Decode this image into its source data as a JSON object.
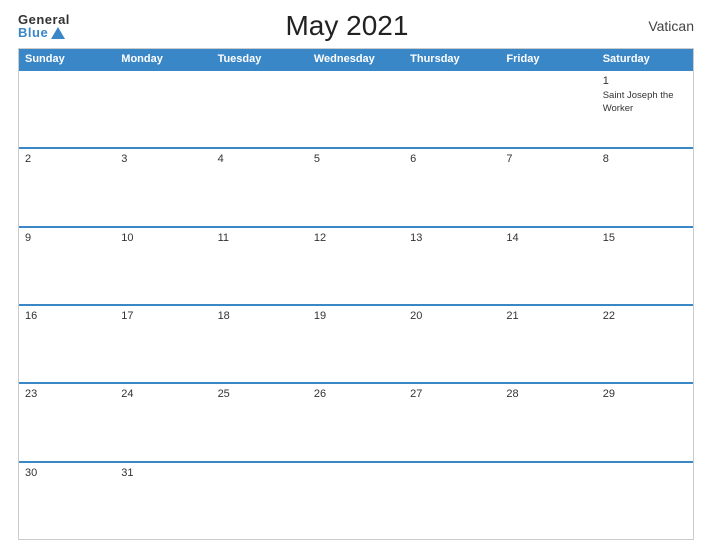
{
  "header": {
    "logo_general": "General",
    "logo_blue": "Blue",
    "title": "May 2021",
    "country": "Vatican"
  },
  "calendar": {
    "day_headers": [
      "Sunday",
      "Monday",
      "Tuesday",
      "Wednesday",
      "Thursday",
      "Friday",
      "Saturday"
    ],
    "weeks": [
      [
        {
          "date": "",
          "event": ""
        },
        {
          "date": "",
          "event": ""
        },
        {
          "date": "",
          "event": ""
        },
        {
          "date": "",
          "event": ""
        },
        {
          "date": "",
          "event": ""
        },
        {
          "date": "",
          "event": ""
        },
        {
          "date": "1",
          "event": "Saint Joseph the Worker"
        }
      ],
      [
        {
          "date": "2",
          "event": ""
        },
        {
          "date": "3",
          "event": ""
        },
        {
          "date": "4",
          "event": ""
        },
        {
          "date": "5",
          "event": ""
        },
        {
          "date": "6",
          "event": ""
        },
        {
          "date": "7",
          "event": ""
        },
        {
          "date": "8",
          "event": ""
        }
      ],
      [
        {
          "date": "9",
          "event": ""
        },
        {
          "date": "10",
          "event": ""
        },
        {
          "date": "11",
          "event": ""
        },
        {
          "date": "12",
          "event": ""
        },
        {
          "date": "13",
          "event": ""
        },
        {
          "date": "14",
          "event": ""
        },
        {
          "date": "15",
          "event": ""
        }
      ],
      [
        {
          "date": "16",
          "event": ""
        },
        {
          "date": "17",
          "event": ""
        },
        {
          "date": "18",
          "event": ""
        },
        {
          "date": "19",
          "event": ""
        },
        {
          "date": "20",
          "event": ""
        },
        {
          "date": "21",
          "event": ""
        },
        {
          "date": "22",
          "event": ""
        }
      ],
      [
        {
          "date": "23",
          "event": ""
        },
        {
          "date": "24",
          "event": ""
        },
        {
          "date": "25",
          "event": ""
        },
        {
          "date": "26",
          "event": ""
        },
        {
          "date": "27",
          "event": ""
        },
        {
          "date": "28",
          "event": ""
        },
        {
          "date": "29",
          "event": ""
        }
      ],
      [
        {
          "date": "30",
          "event": ""
        },
        {
          "date": "31",
          "event": ""
        },
        {
          "date": "",
          "event": ""
        },
        {
          "date": "",
          "event": ""
        },
        {
          "date": "",
          "event": ""
        },
        {
          "date": "",
          "event": ""
        },
        {
          "date": "",
          "event": ""
        }
      ]
    ]
  }
}
